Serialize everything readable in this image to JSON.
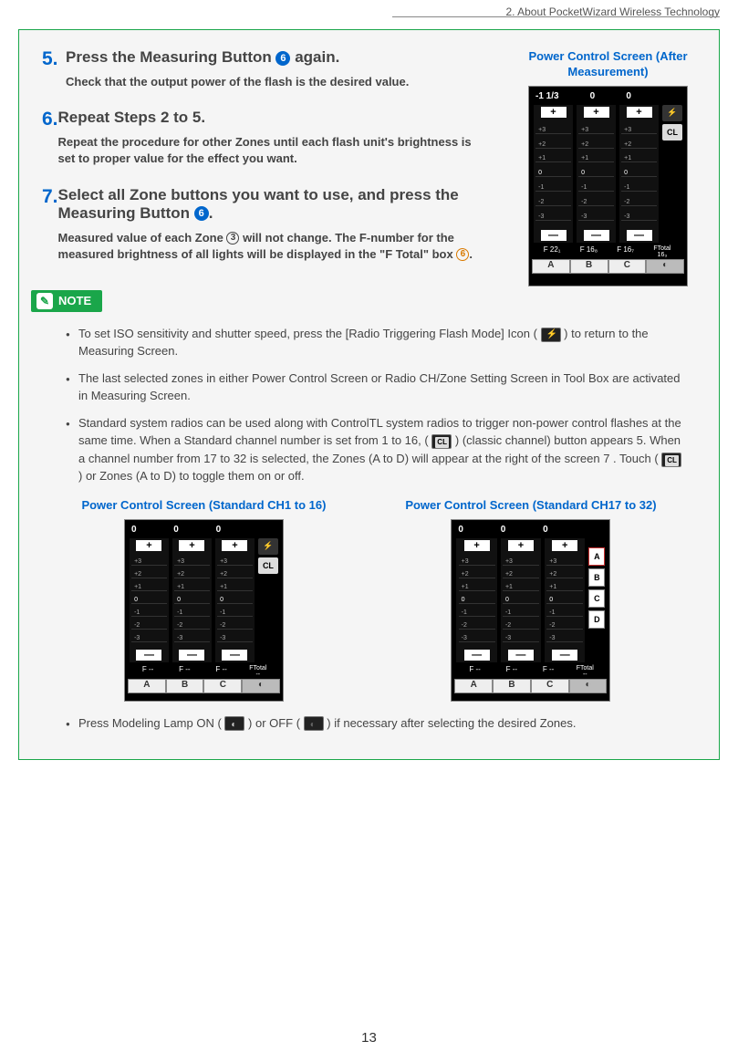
{
  "header": "2.  About PocketWizard Wireless Technology",
  "steps": [
    {
      "num": "5.",
      "title_pre": "Press the Measuring Button ",
      "circle": "6",
      "title_post": " again.",
      "desc": "Check that the output power of the flash is the desired value."
    },
    {
      "num": "6.",
      "title_pre": "Repeat Steps 2 to 5.",
      "circle": "",
      "title_post": "",
      "desc": "Repeat the procedure for other Zones until each flash unit's brightness is set to proper value for the effect you want."
    },
    {
      "num": "7.",
      "title_pre": "Select all Zone buttons you want to use, and press the Measuring Button ",
      "circle": "6",
      "title_post": ".",
      "desc_pre": "Measured value of each Zone ",
      "desc_c1": "3",
      "desc_mid": " will not change. The F-number for the measured brightness of all lights will be displayed in the \"F Total\" box ",
      "desc_c2": "6",
      "desc_post": "."
    }
  ],
  "right_label": "Power Control Screen (After Measurement)",
  "after_screen": {
    "top": [
      "-1 1/3",
      "0",
      "0"
    ],
    "fvals": [
      "F 22₁",
      "F 16₈",
      "F 16₇"
    ],
    "ftotal_label": "FTotal",
    "ftotal": "16₃",
    "zones": [
      "A",
      "B",
      "C"
    ]
  },
  "note_label": "NOTE",
  "notes": {
    "n1_pre": "To set ISO sensitivity and shutter speed, press the [Radio Triggering Flash Mode] Icon ( ",
    "n1_post": " ) to return to the Measuring Screen.",
    "n2": "The last selected zones in either Power Control Screen or Radio CH/Zone Setting Screen in Tool Box are activated in Measuring Screen.",
    "n3_pre": "Standard system radios can be used along with ControlTL system radios to trigger non-power control flashes at the same time. When a Standard channel number is set from 1 to 16, ( ",
    "n3_mid": " ) (classic channel) button appears 5. When a channel number from 17 to 32 is selected, the Zones (A to D) will appear at the right of the screen 7 . Touch ( ",
    "n3_post": " ) or Zones (A to D) to toggle them on or off.",
    "n4_pre": "Press Modeling Lamp ON ( ",
    "n4_mid": " ) or OFF ( ",
    "n4_post": " ) if necessary after selecting the desired Zones."
  },
  "screen_labels": {
    "s1": "Power Control Screen (Standard CH1 to 16)",
    "s2": "Power Control Screen (Standard CH17 to 32)"
  },
  "small_screen": {
    "top": [
      "0",
      "0",
      "0"
    ],
    "fvals": [
      "F  --",
      "F  --",
      "F  --"
    ],
    "ftotal_label": "FTotal",
    "ftotal": "--",
    "zones": [
      "A",
      "B",
      "C"
    ],
    "side_zones": [
      "A",
      "B",
      "C",
      "D"
    ]
  },
  "scale": [
    "+3",
    "+2",
    "+1",
    "0",
    "-1",
    "-2",
    "-3"
  ],
  "plus": "+",
  "minus": "—",
  "cl": "CL",
  "page": "13"
}
